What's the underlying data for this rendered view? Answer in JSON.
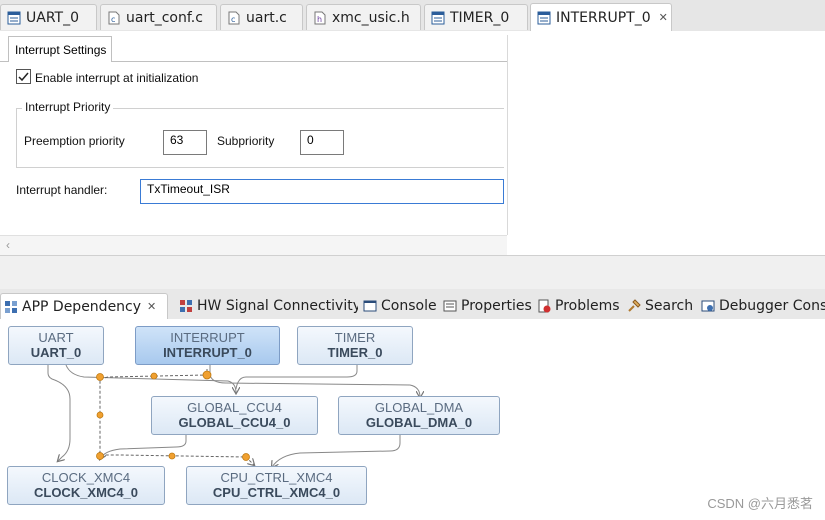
{
  "editor_tabs": [
    {
      "label": "UART_0",
      "icon": "app-config-icon"
    },
    {
      "label": "uart_conf.c",
      "icon": "c-file-icon"
    },
    {
      "label": "uart.c",
      "icon": "c-file-icon"
    },
    {
      "label": "xmc_usic.h",
      "icon": "h-file-icon"
    },
    {
      "label": "TIMER_0",
      "icon": "app-config-icon"
    },
    {
      "label": "INTERRUPT_0",
      "icon": "app-config-icon",
      "active": true
    }
  ],
  "settings": {
    "tab_label": "Interrupt Settings",
    "enable_label": "Enable interrupt at initialization",
    "enable_checked": true,
    "priority_group": "Interrupt Priority",
    "preemption_label": "Preemption priority",
    "preemption_value": "63",
    "subpriority_label": "Subpriority",
    "subpriority_value": "0",
    "handler_label": "Interrupt handler:",
    "handler_value": "TxTimeout_ISR"
  },
  "view_tabs": [
    {
      "label": "APP Dependency",
      "icon": "app-dependency-icon",
      "active": true
    },
    {
      "label": "HW Signal Connectivity",
      "icon": "hw-signal-icon"
    },
    {
      "label": "Console",
      "icon": "console-icon"
    },
    {
      "label": "Properties",
      "icon": "properties-icon"
    },
    {
      "label": "Problems",
      "icon": "problems-icon"
    },
    {
      "label": "Search",
      "icon": "search-icon"
    },
    {
      "label": "Debugger Console",
      "icon": "debugger-console-icon"
    }
  ],
  "nodes": {
    "uart": {
      "type": "UART",
      "name": "UART_0"
    },
    "interrupt": {
      "type": "INTERRUPT",
      "name": "INTERRUPT_0"
    },
    "timer": {
      "type": "TIMER",
      "name": "TIMER_0"
    },
    "global_ccu4": {
      "type": "GLOBAL_CCU4",
      "name": "GLOBAL_CCU4_0"
    },
    "global_dma": {
      "type": "GLOBAL_DMA",
      "name": "GLOBAL_DMA_0"
    },
    "clock": {
      "type": "CLOCK_XMC4",
      "name": "CLOCK_XMC4_0"
    },
    "cpu_ctrl": {
      "type": "CPU_CTRL_XMC4",
      "name": "CPU_CTRL_XMC4_0"
    }
  },
  "watermark": "CSDN @六月悉茗",
  "colors": {
    "selected_node": "#a8c9ee",
    "link_dot": "#f0a030",
    "node_border": "#8fa5c0"
  }
}
